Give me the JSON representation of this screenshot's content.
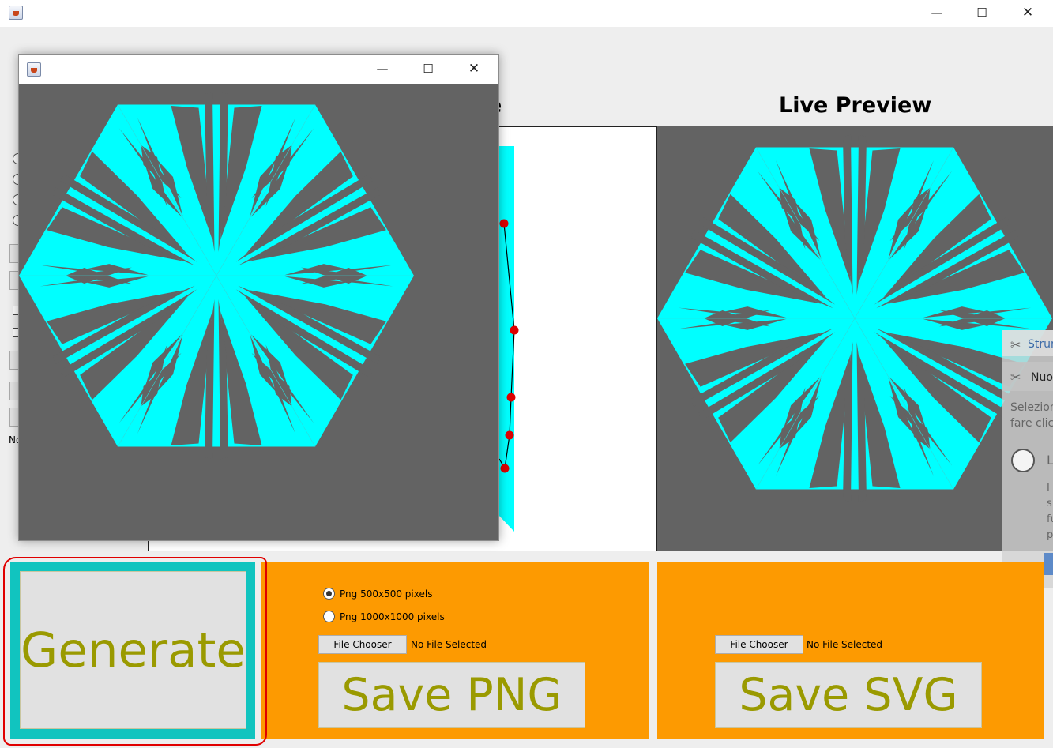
{
  "main_window": {
    "controls": {
      "minimize": "—",
      "maximize": "☐",
      "close": "✕"
    }
  },
  "headings": {
    "editor_tail": "e",
    "live_preview": "Live Preview"
  },
  "left_controls": {
    "status_fragment": "No"
  },
  "generate": {
    "label": "Generate"
  },
  "png_export": {
    "options": [
      {
        "label": "Png 500x500 pixels",
        "selected": true
      },
      {
        "label": "Png 1000x1000 pixels",
        "selected": false
      }
    ],
    "file_chooser_label": "File Chooser",
    "file_status": "No File Selected",
    "save_label": "Save PNG"
  },
  "svg_export": {
    "file_chooser_label": "File Chooser",
    "file_status": "No File Selected",
    "save_label": "Save SVG"
  },
  "float_window": {
    "controls": {
      "minimize": "—",
      "maximize": "☐",
      "close": "✕"
    }
  },
  "overlay_menu": {
    "item1": "Strum",
    "item2": "Nuo",
    "desc_line1": "Selezion",
    "desc_line2": "fare clic",
    "heading_initial": "L",
    "frag1": "I",
    "frag2": "s",
    "frag3": "fu",
    "frag4": "p"
  },
  "colors": {
    "snowflake": "#00ffff",
    "canvas": "#636363",
    "orange_panel": "#fd9a01",
    "teal_panel": "#11c4bf",
    "button_text": "#9a9a00",
    "control_point": "#dd0000",
    "highlight": "#e00000"
  },
  "icons": {
    "app": "java-cup-icon",
    "overlay": [
      "scissors-icon",
      "snip-icon",
      "mountain-icon"
    ]
  }
}
